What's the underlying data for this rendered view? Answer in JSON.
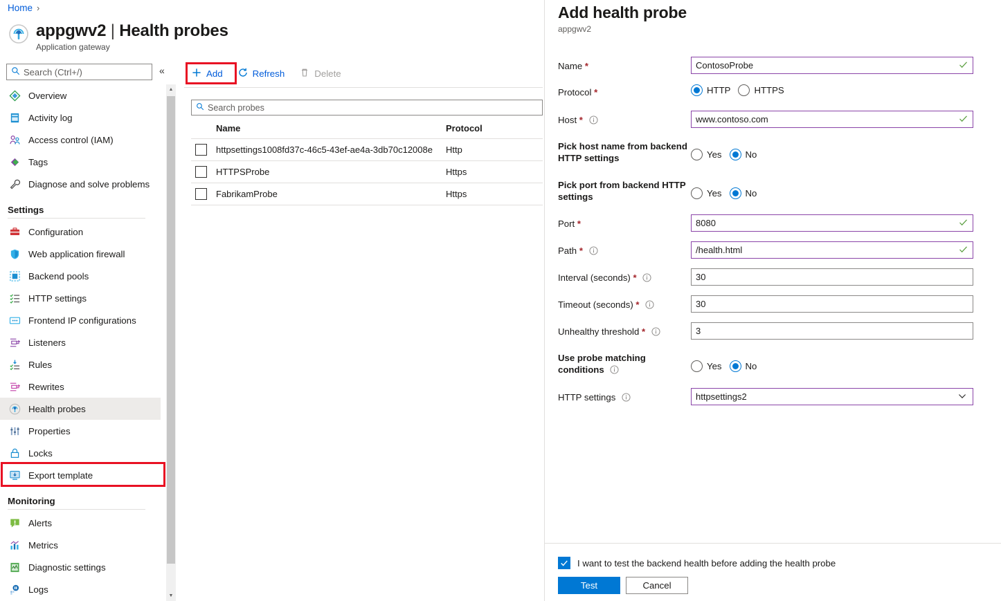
{
  "breadcrumb": {
    "home": "Home",
    "separator": "›"
  },
  "header": {
    "resource_name": "appgwv2",
    "separator": "|",
    "page_title": "Health probes",
    "full_title": "appgwv2 | Health probes",
    "subtitle": "Application gateway",
    "icon": "application-gateway-icon"
  },
  "sidebar": {
    "search_placeholder": "Search (Ctrl+/)",
    "collapse_label": "«",
    "items": [
      {
        "label": "Overview",
        "icon": "overview-icon",
        "selected": false
      },
      {
        "label": "Activity log",
        "icon": "activity-log-icon",
        "selected": false
      },
      {
        "label": "Access control (IAM)",
        "icon": "access-control-icon",
        "selected": false
      },
      {
        "label": "Tags",
        "icon": "tags-icon",
        "selected": false
      },
      {
        "label": "Diagnose and solve problems",
        "icon": "diagnose-icon",
        "selected": false
      }
    ],
    "groups": [
      {
        "title": "Settings",
        "items": [
          {
            "label": "Configuration",
            "icon": "configuration-icon",
            "selected": false
          },
          {
            "label": "Web application firewall",
            "icon": "shield-icon",
            "selected": false
          },
          {
            "label": "Backend pools",
            "icon": "backend-pools-icon",
            "selected": false
          },
          {
            "label": "HTTP settings",
            "icon": "http-settings-icon",
            "selected": false
          },
          {
            "label": "Frontend IP configurations",
            "icon": "frontend-ip-icon",
            "selected": false
          },
          {
            "label": "Listeners",
            "icon": "listeners-icon",
            "selected": false
          },
          {
            "label": "Rules",
            "icon": "rules-icon",
            "selected": false
          },
          {
            "label": "Rewrites",
            "icon": "rewrites-icon",
            "selected": false
          },
          {
            "label": "Health probes",
            "icon": "health-probes-icon",
            "selected": true
          },
          {
            "label": "Properties",
            "icon": "properties-icon",
            "selected": false
          },
          {
            "label": "Locks",
            "icon": "lock-icon",
            "selected": false
          },
          {
            "label": "Export template",
            "icon": "export-template-icon",
            "selected": false
          }
        ]
      },
      {
        "title": "Monitoring",
        "items": [
          {
            "label": "Alerts",
            "icon": "alerts-icon",
            "selected": false
          },
          {
            "label": "Metrics",
            "icon": "metrics-icon",
            "selected": false
          },
          {
            "label": "Diagnostic settings",
            "icon": "diagnostic-settings-icon",
            "selected": false
          },
          {
            "label": "Logs",
            "icon": "logs-icon",
            "selected": false
          }
        ]
      }
    ]
  },
  "toolbar": {
    "add_label": "Add",
    "refresh_label": "Refresh",
    "delete_label": "Delete",
    "delete_disabled": true
  },
  "probe_list": {
    "search_placeholder": "Search probes",
    "columns": [
      "Name",
      "Protocol"
    ],
    "rows": [
      {
        "name": "httpsettings1008fd37c-46c5-43ef-ae4a-3db70c12008e",
        "protocol": "Http"
      },
      {
        "name": "HTTPSProbe",
        "protocol": "Https"
      },
      {
        "name": "FabrikamProbe",
        "protocol": "Https"
      }
    ]
  },
  "panel": {
    "title": "Add health probe",
    "subtitle": "appgwv2",
    "fields": [
      {
        "label": "Name",
        "required": true,
        "info": false,
        "type": "text",
        "value": "ContosoProbe",
        "validated": true
      },
      {
        "label": "Protocol",
        "required": true,
        "info": false,
        "type": "radio",
        "options": [
          "HTTP",
          "HTTPS"
        ],
        "value": "HTTP"
      },
      {
        "label": "Host",
        "required": true,
        "info": true,
        "type": "text",
        "value": "www.contoso.com",
        "validated": true
      },
      {
        "label": "Pick host name from backend HTTP settings",
        "required": false,
        "info": false,
        "type": "radio",
        "options": [
          "Yes",
          "No"
        ],
        "value": "No"
      },
      {
        "label": "Pick port from backend HTTP settings",
        "required": false,
        "info": false,
        "type": "radio",
        "options": [
          "Yes",
          "No"
        ],
        "value": "No"
      },
      {
        "label": "Port",
        "required": true,
        "info": false,
        "type": "text",
        "value": "8080",
        "validated": true
      },
      {
        "label": "Path",
        "required": true,
        "info": true,
        "type": "text",
        "value": "/health.html",
        "validated": true
      },
      {
        "label": "Interval (seconds)",
        "required": true,
        "info": true,
        "type": "text",
        "value": "30",
        "validated": false
      },
      {
        "label": "Timeout (seconds)",
        "required": true,
        "info": true,
        "type": "text",
        "value": "30",
        "validated": false
      },
      {
        "label": "Unhealthy threshold",
        "required": true,
        "info": true,
        "type": "text",
        "value": "3",
        "validated": false
      },
      {
        "label": "Use probe matching conditions",
        "required": false,
        "info": true,
        "type": "radio",
        "options": [
          "Yes",
          "No"
        ],
        "value": "No"
      },
      {
        "label": "HTTP settings",
        "required": false,
        "info": true,
        "type": "select",
        "value": "httpsettings2",
        "validated": true
      }
    ],
    "footer": {
      "checkbox_label": "I want to test the backend health before adding the health probe",
      "checkbox_checked": true,
      "test_label": "Test",
      "cancel_label": "Cancel"
    }
  },
  "colors": {
    "accent": "#0078d4",
    "link": "#015cda",
    "highlight_border": "#e81123",
    "validated_border": "#8a44a8",
    "required_asterisk": "#a4262c",
    "valid_check": "#5a9e3f"
  }
}
